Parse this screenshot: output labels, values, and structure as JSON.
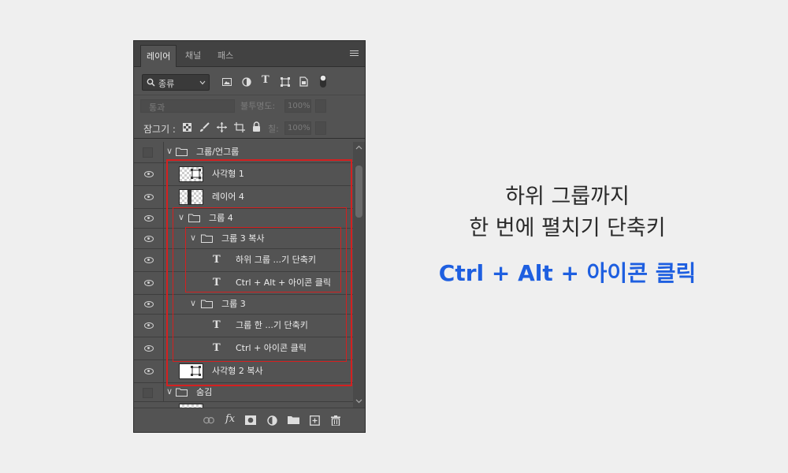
{
  "panel": {
    "tabs": [
      {
        "label": "레이어",
        "active": true
      },
      {
        "label": "채널",
        "active": false
      },
      {
        "label": "패스",
        "active": false
      }
    ],
    "filter": {
      "label": "종류"
    },
    "blend": {
      "mode": "통과",
      "opacity_label": "불투명도:",
      "opacity_value": "100%"
    },
    "lock": {
      "label": "잠그기 :",
      "fill_label": "칠:",
      "fill_value": "100%"
    },
    "layers": [
      {
        "name": "그룹/언그룹",
        "kind": "group",
        "visible": false
      },
      {
        "name": "사각형 1",
        "kind": "shape",
        "visible": true
      },
      {
        "name": "레이어 4",
        "kind": "pixel",
        "visible": true
      },
      {
        "name": "그룹 4",
        "kind": "group",
        "visible": true
      },
      {
        "name": "그룹 3 복사",
        "kind": "group",
        "visible": true
      },
      {
        "name": "하위 그룹 ...기 단축키",
        "kind": "text",
        "visible": true
      },
      {
        "name": "Ctrl + Alt + 아이콘  클릭",
        "kind": "text",
        "visible": true
      },
      {
        "name": "그룹 3",
        "kind": "group",
        "visible": true
      },
      {
        "name": "그룹 한 ...기 단축키",
        "kind": "text",
        "visible": true
      },
      {
        "name": "Ctrl + 아이콘  클릭",
        "kind": "text",
        "visible": true
      },
      {
        "name": "사각형 2 복사",
        "kind": "shape",
        "visible": true
      },
      {
        "name": "숨김",
        "kind": "group",
        "visible": false
      }
    ]
  },
  "caption": {
    "line1": "하위 그룹까지",
    "line2": "한 번에 펼치기 단축키",
    "shortcut": "Ctrl + Alt + 아이콘 클릭"
  },
  "colors": {
    "highlight": "#d42020",
    "shortcut": "#1e5fe0",
    "panel_bg": "#535353"
  }
}
